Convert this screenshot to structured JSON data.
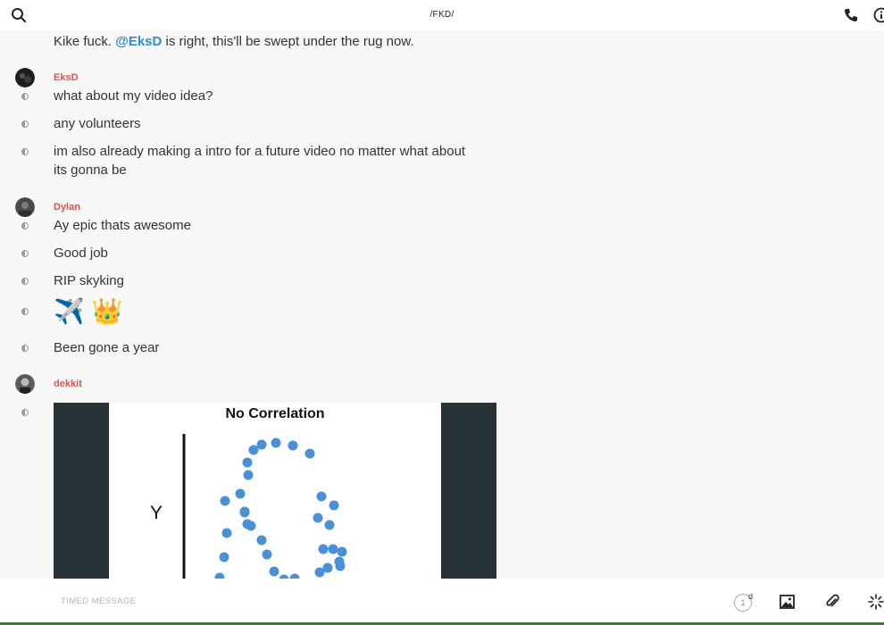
{
  "header": {
    "title": "/FKD/",
    "icons": [
      "search-icon",
      "phone-icon",
      "info-icon"
    ]
  },
  "messages": [
    {
      "author": null,
      "segments": [
        {
          "text": "Kike fuck. "
        },
        {
          "text": "@EksD",
          "mention": true
        },
        {
          "text": " is right, this'll be swept under the rug now."
        }
      ]
    },
    {
      "author": "EksD",
      "lines": [
        "what about my video idea?",
        "any volunteers",
        "im also already making a intro for a future video no matter what about its gonna be"
      ]
    },
    {
      "author": "Dylan",
      "lines": [
        "Ay epic thats awesome",
        "Good job",
        "RIP skyking",
        "✈️ 👑",
        "Been gone a year"
      ]
    },
    {
      "author": "dekkit",
      "attachment": {
        "type": "image",
        "title": "No Correlation",
        "axis_label": "Y"
      }
    }
  ],
  "composer": {
    "placeholder": "TIMED MESSAGE",
    "timer_value": "1",
    "timer_unit": "d",
    "icons": [
      "timer-icon",
      "image-icon",
      "paperclip-icon",
      "sparkle-icon"
    ]
  },
  "colors": {
    "username": "#d9534f",
    "mention": "#2a8fd4",
    "attachment_bg": "#263238",
    "dot_color": "#4a90d9"
  }
}
